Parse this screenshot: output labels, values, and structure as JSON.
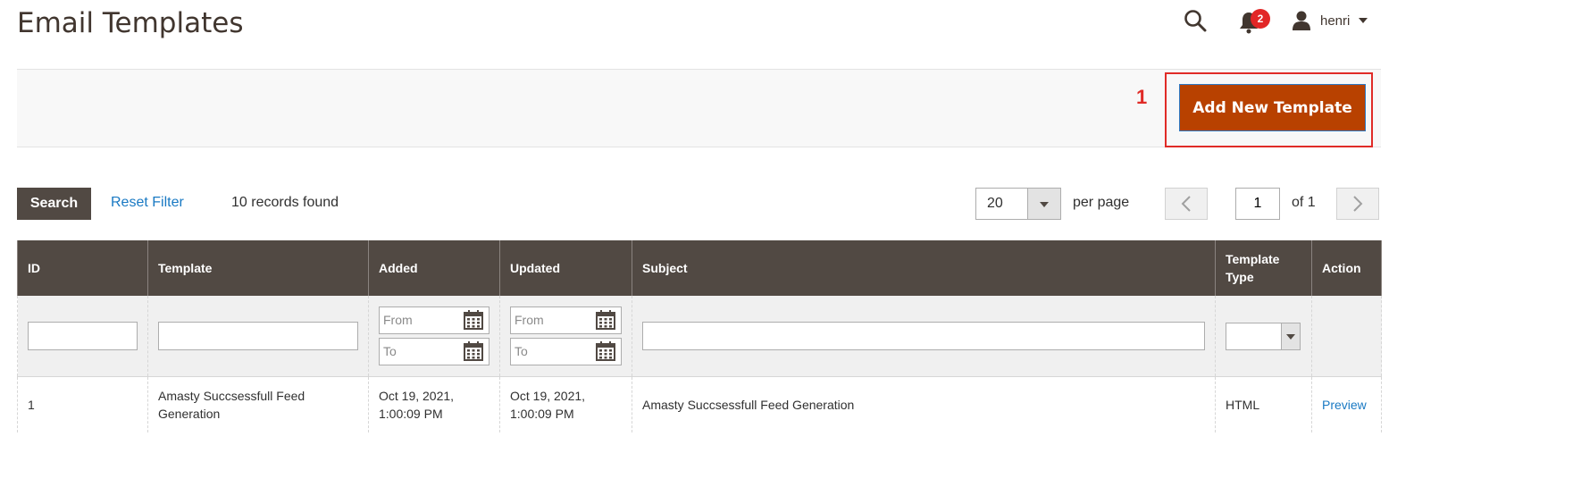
{
  "page": {
    "title": "Email Templates"
  },
  "header": {
    "notification_count": "2",
    "username": "henri"
  },
  "annotation": {
    "step": "1"
  },
  "actions": {
    "add_new_label": "Add New Template"
  },
  "toolbar": {
    "search_label": "Search",
    "reset_label": "Reset Filter",
    "records_found": "10 records found",
    "per_page_value": "20",
    "per_page_label": "per page",
    "current_page": "1",
    "of_pages": "of 1"
  },
  "grid": {
    "columns": [
      "ID",
      "Template",
      "Added",
      "Updated",
      "Subject",
      "Template Type",
      "Action"
    ],
    "filters": {
      "from_placeholder": "From",
      "to_placeholder": "To"
    },
    "rows": [
      {
        "id": "1",
        "template": "Amasty Succsessfull Feed Generation",
        "added": "Oct 19, 2021, 1:00:09 PM",
        "updated": "Oct 19, 2021, 1:00:09 PM",
        "subject": "Amasty Succsessfull Feed Generation",
        "type": "HTML",
        "action": "Preview"
      }
    ]
  },
  "colors": {
    "header_bg": "#514943",
    "primary_button": "#b84100",
    "link": "#1979c3",
    "annotation": "#e02b27",
    "badge": "#e22626"
  },
  "icons": [
    "search-icon",
    "bell-icon",
    "user-icon",
    "calendar-icon",
    "chevron-left-icon",
    "chevron-right-icon",
    "caret-down-icon"
  ]
}
